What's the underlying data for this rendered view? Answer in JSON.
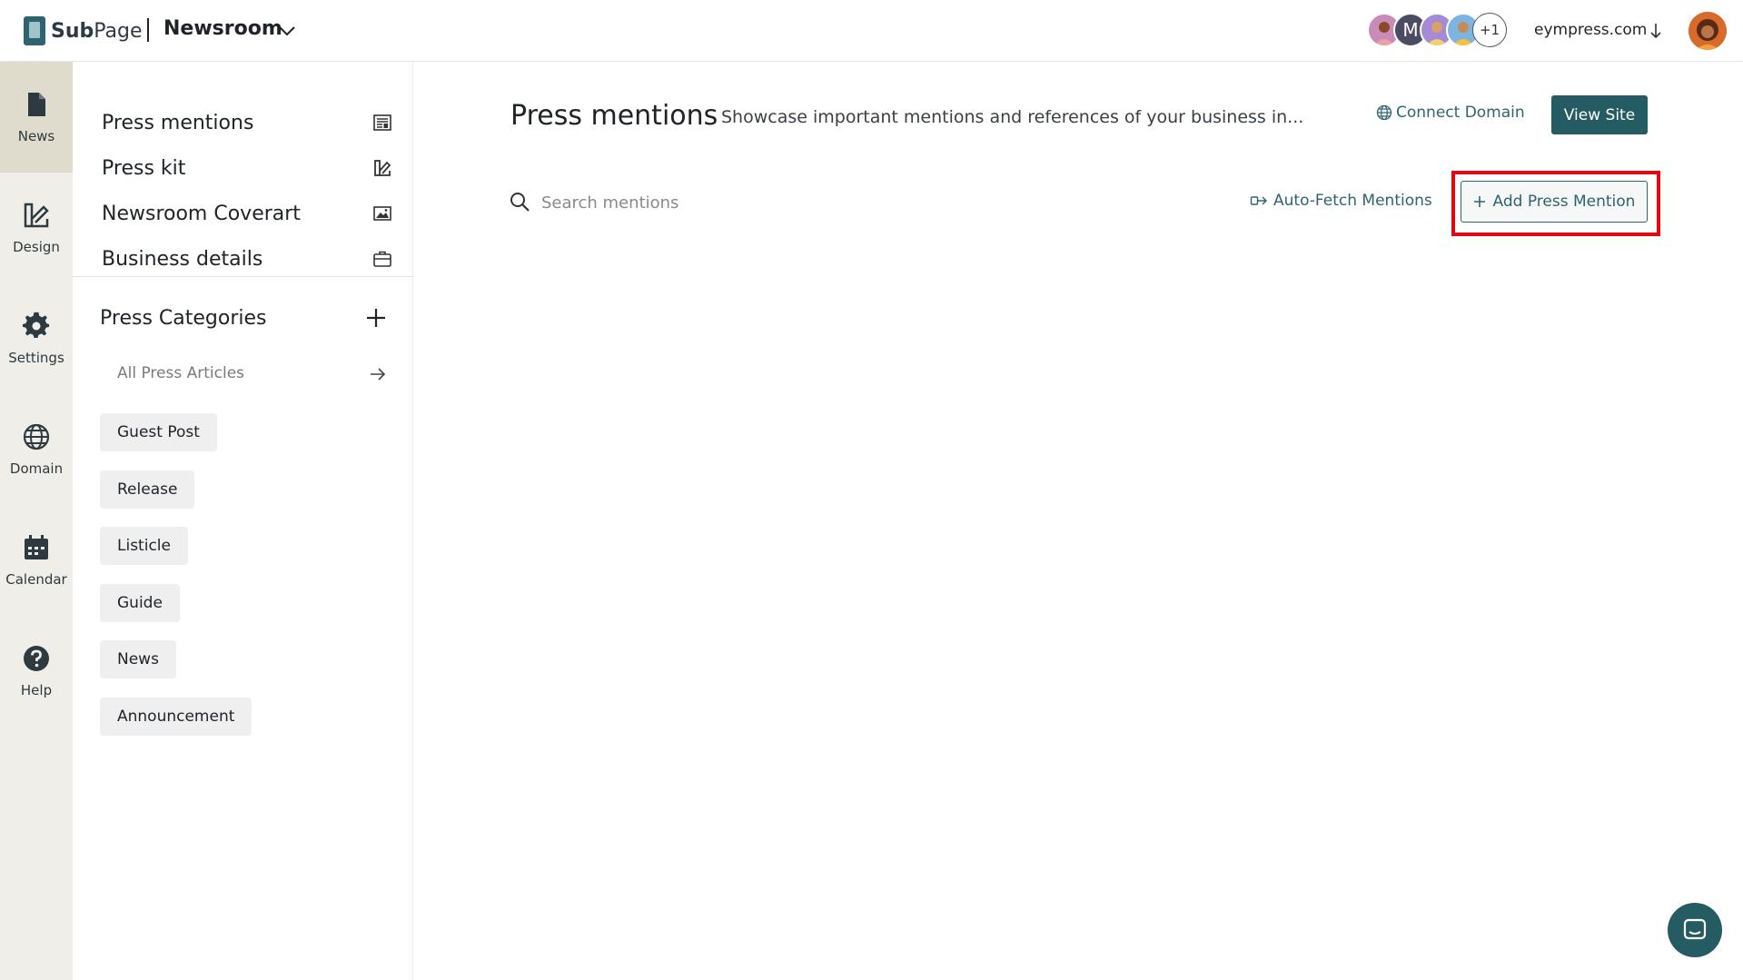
{
  "header": {
    "brand": {
      "prefix": "Sub",
      "suffix": "Page"
    },
    "workspace": "Newsroom",
    "collaborators": {
      "initial": "M",
      "extra": "+1"
    },
    "domain": "eympress.com"
  },
  "rail": {
    "items": [
      {
        "label": "News",
        "icon": "document-icon",
        "active": true
      },
      {
        "label": "Design",
        "icon": "design-icon"
      },
      {
        "label": "Settings",
        "icon": "gear-icon"
      },
      {
        "label": "Domain",
        "icon": "globe-icon"
      },
      {
        "label": "Calendar",
        "icon": "calendar-icon"
      },
      {
        "label": "Help",
        "icon": "help-icon"
      }
    ]
  },
  "subnav": {
    "links": [
      {
        "label": "Press mentions",
        "icon": "newspaper-icon"
      },
      {
        "label": "Press kit",
        "icon": "design-icon"
      },
      {
        "label": "Newsroom Coverart",
        "icon": "image-icon"
      },
      {
        "label": "Business details",
        "icon": "briefcase-icon"
      }
    ],
    "categories_title": "Press Categories",
    "all_articles": "All Press Articles",
    "categories": [
      "Guest Post",
      "Release",
      "Listicle",
      "Guide",
      "News",
      "Announcement"
    ]
  },
  "main": {
    "title": "Press mentions",
    "description": "Showcase important mentions and references of your business in...",
    "connect_domain": "Connect Domain",
    "view_site": "View Site",
    "search_placeholder": "Search mentions",
    "auto_fetch": "Auto-Fetch Mentions",
    "add_mention": "Add Press Mention"
  },
  "colors": {
    "accent": "#255b63",
    "rail_bg": "#efeee9",
    "rail_active": "#e0dccd",
    "highlight": "#e30613"
  }
}
